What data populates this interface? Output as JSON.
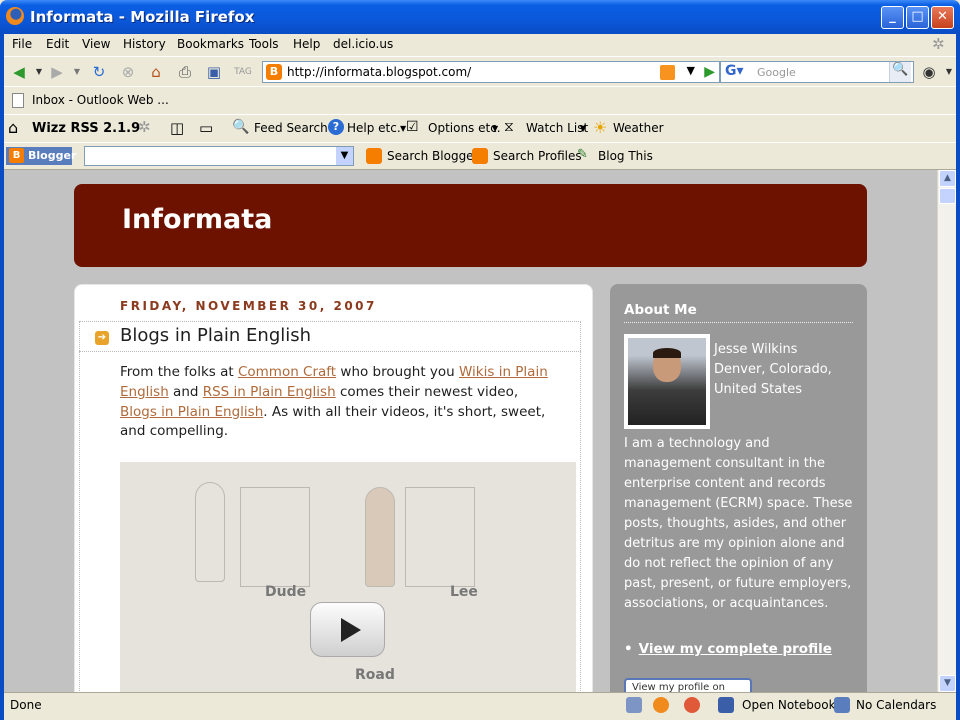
{
  "window": {
    "title": "Informata - Mozilla Firefox"
  },
  "menu": [
    "File",
    "Edit",
    "View",
    "History",
    "Bookmarks",
    "Tools",
    "Help",
    "del.icio.us"
  ],
  "nav": {
    "url": "http://informata.blogspot.com/",
    "search_placeholder": "Google"
  },
  "bookmarks": {
    "item": "Inbox - Outlook Web ..."
  },
  "wizz": {
    "name": "Wizz RSS 2.1.9",
    "feed_search": "Feed Search",
    "help": "Help etc.",
    "options": "Options etc.",
    "watch": "Watch List",
    "weather": "Weather"
  },
  "blogger_bar": {
    "logo": "Blogger",
    "search_blogger": "Search Blogger",
    "search_profiles": "Search Profiles",
    "blog_this": "Blog This"
  },
  "blog": {
    "title": "Informata",
    "date": "FRIDAY, NOVEMBER 30, 2007",
    "post_title": "Blogs in Plain English",
    "body": {
      "t1": "From the folks at ",
      "l1": "Common Craft",
      "t2": " who brought you ",
      "l2": "Wikis in Plain English",
      "t3": " and ",
      "l3": "RSS in Plain English",
      "t4": " comes their newest video, ",
      "l4": "Blogs in Plain English",
      "t5": ". As with all their videos, it's short, sweet, and compelling."
    },
    "video": {
      "cap1": "Dude",
      "cap2": "Lee",
      "cap3": "Road"
    }
  },
  "sidebar": {
    "title": "About Me",
    "name": "Jesse Wilkins",
    "location_line1": "Denver, Colorado,",
    "location_line2": "United States",
    "bio": "I am a technology and management consultant in the enterprise content and records management (ECRM) space. These posts, thoughts, asides, and other detritus are my opinion alone and do not reflect the opinion of any past, present, or future employers, associations, or acquaintances.",
    "profile_link": "View my complete profile",
    "badge": "View my profile on"
  },
  "status": {
    "text": "Done",
    "notebook": "Open Notebook",
    "calendars": "No Calendars"
  },
  "colors": {
    "header_bg": "#6e1200",
    "sidebar_bg": "#999999",
    "link": "#b06a3a",
    "date": "#8b3a1e"
  }
}
